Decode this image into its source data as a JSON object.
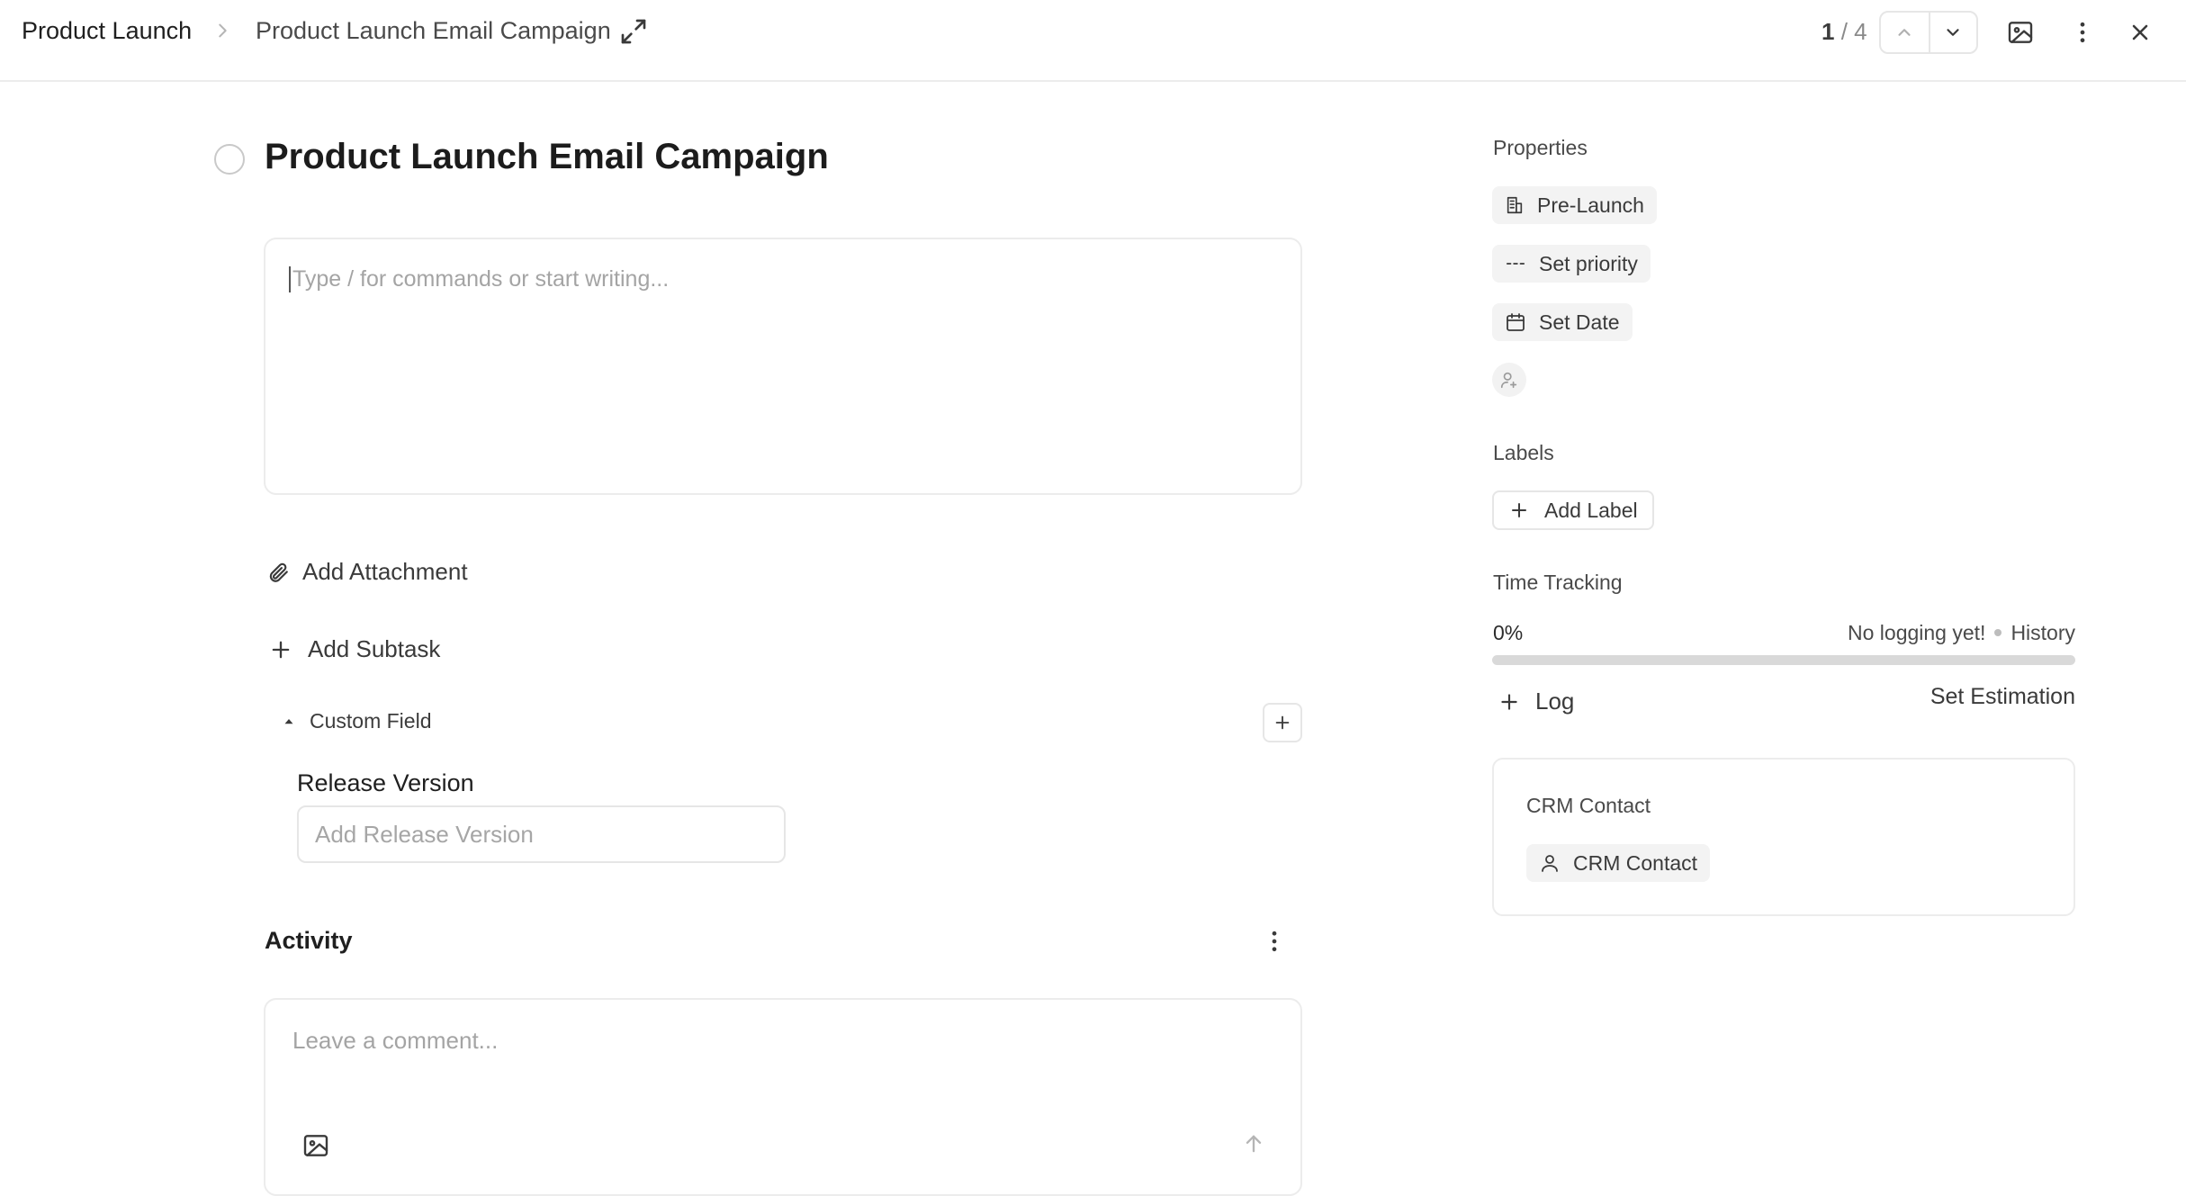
{
  "header": {
    "breadcrumb_root": "Product Launch",
    "breadcrumb_current": "Product Launch Email Campaign",
    "pager_current": "1",
    "pager_total": "/ 4"
  },
  "task": {
    "title": "Product Launch Email Campaign",
    "editor_placeholder": "Type / for commands or start writing...",
    "add_attachment_label": "Add Attachment",
    "add_subtask_label": "Add Subtask",
    "custom_field_label": "Custom Field",
    "release_version_label": "Release Version",
    "release_version_placeholder": "Add Release Version",
    "release_version_value": ""
  },
  "activity": {
    "title": "Activity",
    "comment_placeholder": "Leave a comment..."
  },
  "properties": {
    "title": "Properties",
    "stage": "Pre-Launch",
    "priority": "Set priority",
    "date": "Set Date"
  },
  "labels": {
    "title": "Labels",
    "add_label": "Add Label"
  },
  "time_tracking": {
    "title": "Time Tracking",
    "percent": "0%",
    "progress_fraction": 0.0,
    "no_logging": "No logging yet!",
    "history": "History",
    "log_label": "Log",
    "set_estimation": "Set Estimation"
  },
  "crm": {
    "title": "CRM Contact",
    "chip_label": "CRM Contact"
  },
  "icons": {
    "breadcrumb_separator": "chevron-right-icon",
    "expand": "expand-icon",
    "prev": "chevron-up-icon",
    "next": "chevron-down-icon",
    "cover_image": "image-icon",
    "more": "more-vertical-icon",
    "close": "close-icon"
  },
  "colors": {
    "border": "#ececec",
    "chip_bg": "#f3f3f3",
    "text_primary": "#1f1f1f",
    "text_muted": "#a4a4a4"
  }
}
